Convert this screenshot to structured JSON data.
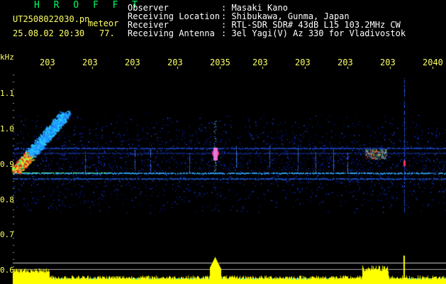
{
  "header": {
    "title": "H R O F F T",
    "filename": "UT2508022030.pn",
    "meteor_label": "meteor",
    "datetime": "25.08.02 20:30",
    "count": "77."
  },
  "info": [
    {
      "label": "Observer",
      "value": ": Masaki Kano"
    },
    {
      "label": "Receiving Location",
      "value": ": Shibukawa, Gunma, Japan"
    },
    {
      "label": "Receiver",
      "value": ": RTL-SDR SDR# 43dB L15 103.2MHz CW"
    },
    {
      "label": "Receiving Antenna",
      "value": ": 3el Yagi(V) Az 330 for Vladivostok"
    }
  ],
  "axis": {
    "unit": "kHz",
    "y_ticks": [
      "1.1",
      "1.0",
      "0.9",
      "0.8",
      "0.7",
      "0.6"
    ],
    "x_ticks": [
      "203",
      "203",
      "203",
      "203",
      "2035",
      "203",
      "203",
      "203",
      "203",
      "2040"
    ]
  },
  "colors": {
    "background": "#000000",
    "text_yellow": "#ffff66",
    "title_green": "#00ff66",
    "bottom_bar": "#ffff00",
    "bottom_fill": "#00ccff"
  }
}
